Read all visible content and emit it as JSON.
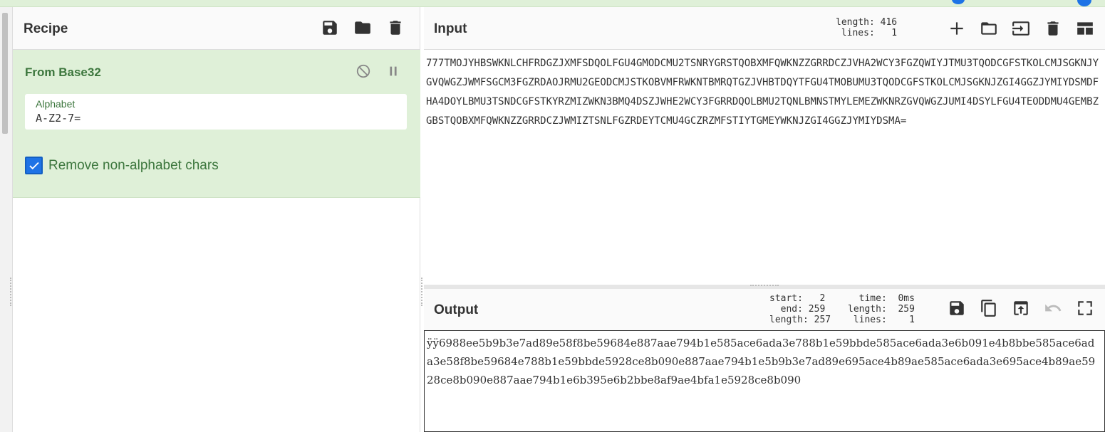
{
  "recipe": {
    "title": "Recipe",
    "icons": [
      "save-icon",
      "folder-icon",
      "trash-icon"
    ],
    "operation": {
      "title": "From Base32",
      "alphabet_label": "Alphabet",
      "alphabet_value": "A-Z2-7=",
      "remove_non_alphabet_label": "Remove non-alphabet chars",
      "remove_non_alphabet_checked": true
    }
  },
  "input": {
    "title": "Input",
    "stats": {
      "length": "length: 416",
      "lines": " lines:   1"
    },
    "text": "777TMOJYHBSWKNLCHFRDGZJXMFSDQOLFGU4GMODCMU2TSNRYGRSTQOBXMFQWKNZZGRRDCZJVHA2WCY3FGZQWIYJTMU3TQODCGFSTKOLCMJSGKNJYGVQWGZJWMFSGCM3FGZRDAOJRMU2GEODCMJSTKOBVMFRWKNTBMRQTGZJVHBTDQYTFGU4TMOBUMU3TQODCGFSTKOLCMJSGKNJZGI4GGZJYMIYDSMDFHA4DOYLBMU3TSNDCGFSTKYRZMIZWKN3BMQ4DSZJWHE2WCY3FGRRDQOLBMU2TQNLBMNSTMYLEMEZWKNRZGVQWGZJUMI4DSYLFGU4TEODDMU4GEMBZGBSTQOBXMFQWKNZZGRRDCZJWMIZTSNLFGZRDEYTCMU4GCZRZMFSTIYTGMEYWKNJZGI4GGZJYMIYDSMA="
  },
  "output": {
    "title": "Output",
    "stats": {
      "col1": "start:   2\n  end: 259\nlength: 257",
      "col2": "  time:  0ms\nlength:  259\n lines:    1"
    },
    "text": "ÿÿ6988ee5b9b3e7ad89e58f8be59684e887aae794b1e585ace6ada3e788b1e59bbde585ace6ada3e6b091e4b8bbe585ace6ada3e58f8be59684e788b1e59bbde5928ce8b090e887aae794b1e5b9b3e7ad89e695ace4b89ae585ace6ada3e695ace4b89ae5928ce8b090e887aae794b1e6b395e6b2bbe8af9ae4bfa1e5928ce8b090"
  }
}
